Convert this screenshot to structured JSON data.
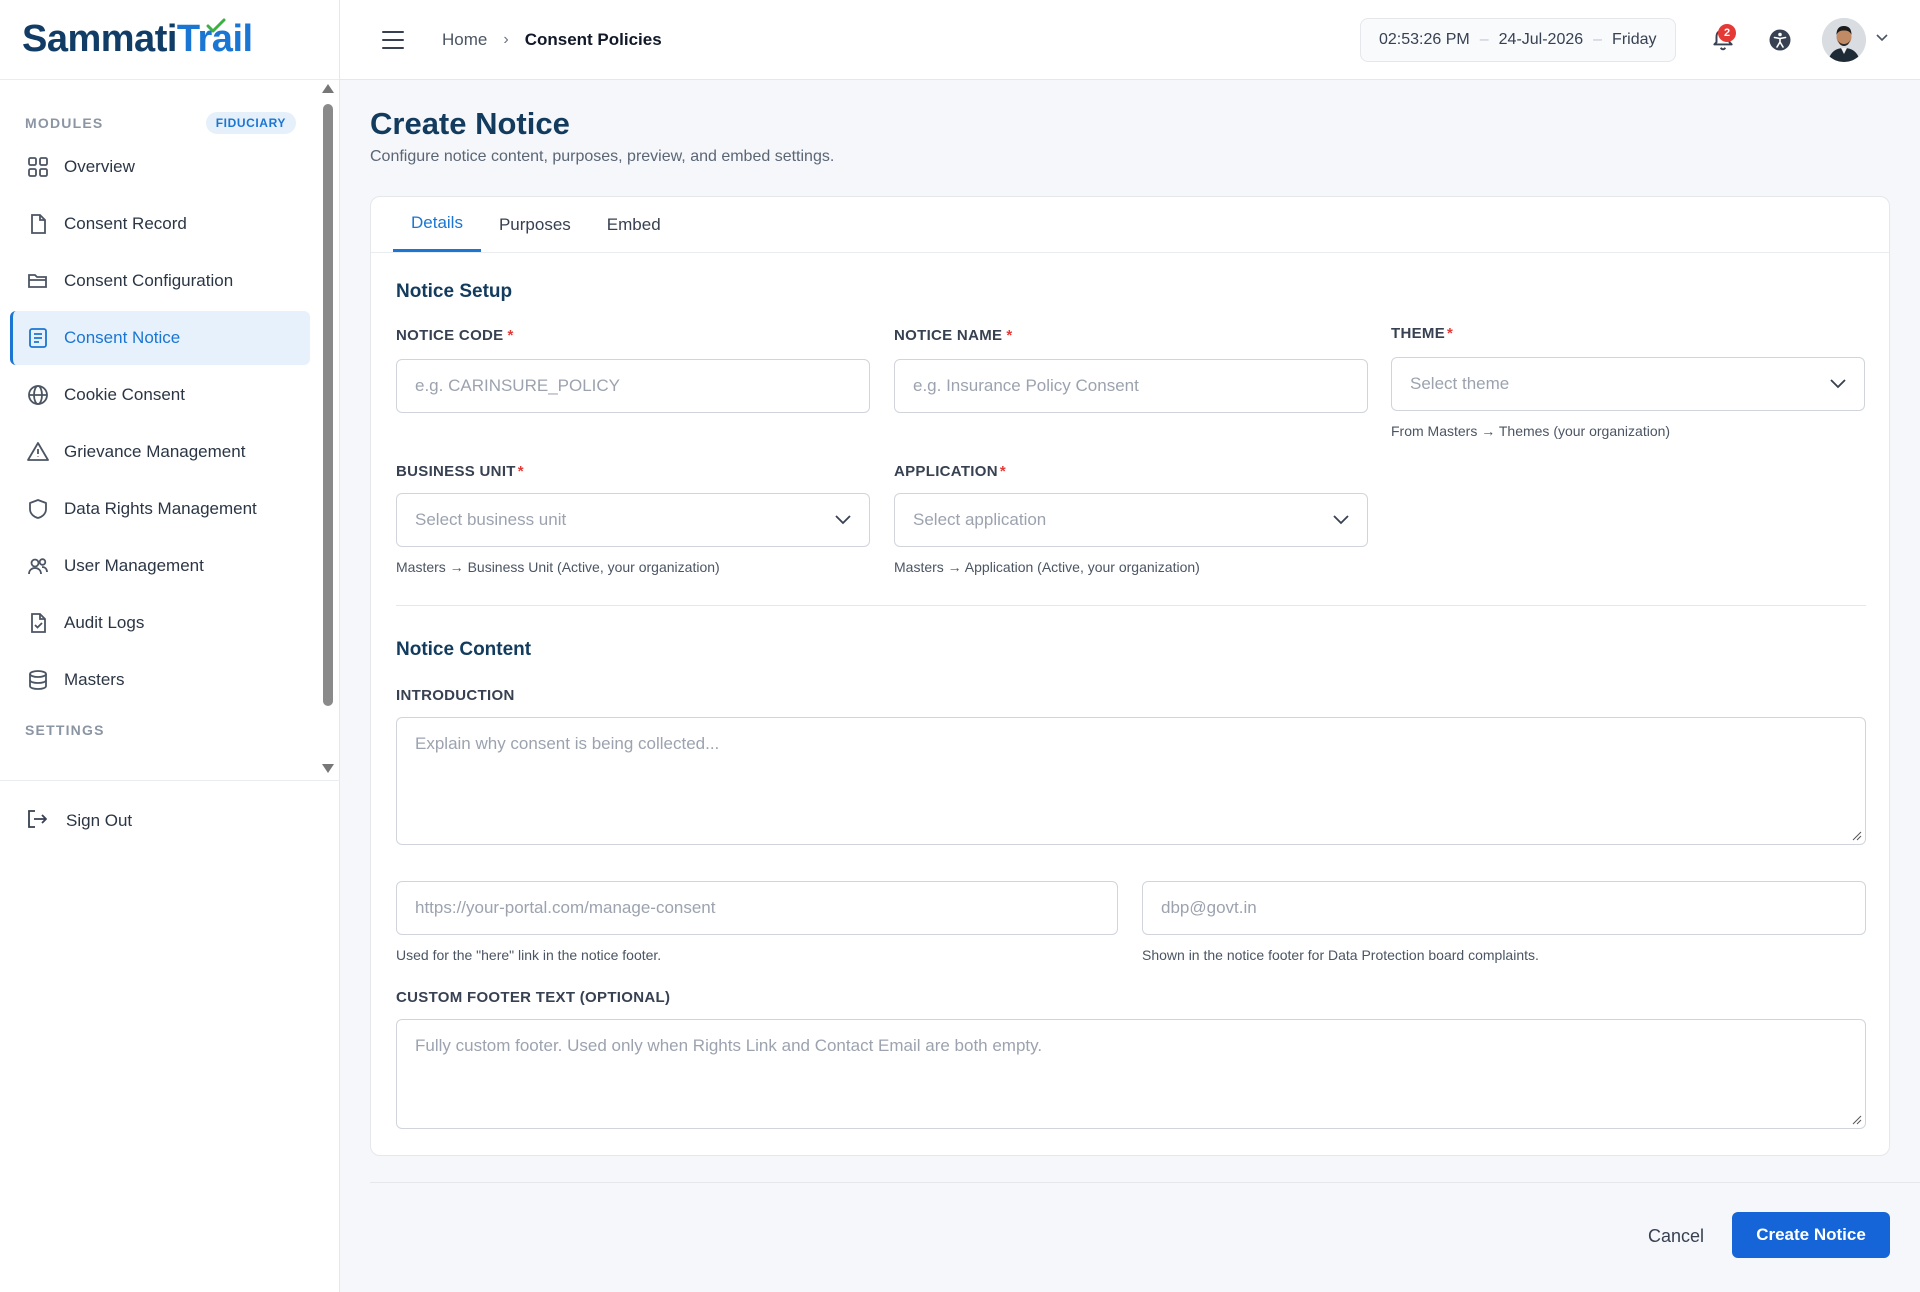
{
  "brand": {
    "part1": "Sammati",
    "part2": "Trail"
  },
  "sidebar": {
    "section_title": "MODULES",
    "badge": "FIDUCIARY",
    "items": [
      {
        "label": "Overview",
        "icon": "grid-icon"
      },
      {
        "label": "Consent Record",
        "icon": "file-icon"
      },
      {
        "label": "Consent Configuration",
        "icon": "folder-icon"
      },
      {
        "label": "Consent Notice",
        "icon": "notice-icon",
        "active": true
      },
      {
        "label": "Cookie Consent",
        "icon": "globe-icon"
      },
      {
        "label": "Grievance Management",
        "icon": "warning-icon"
      },
      {
        "label": "Data Rights Management",
        "icon": "shield-icon"
      },
      {
        "label": "User Management",
        "icon": "users-icon"
      },
      {
        "label": "Audit Logs",
        "icon": "file-check-icon"
      },
      {
        "label": "Masters",
        "icon": "database-icon"
      }
    ],
    "settings_title": "SETTINGS",
    "signout": "Sign Out"
  },
  "header": {
    "breadcrumb_home": "Home",
    "breadcrumb_current": "Consent Policies",
    "time": "02:53:26 PM",
    "date": "24-Jul-2026",
    "day": "Friday",
    "notification_count": "2"
  },
  "page": {
    "title": "Create Notice",
    "subtitle": "Configure notice content, purposes, preview, and embed settings."
  },
  "tabs": [
    "Details",
    "Purposes",
    "Embed"
  ],
  "form": {
    "setup_title": "Notice Setup",
    "notice_code_label": "NOTICE CODE",
    "notice_code_placeholder": "e.g. CARINSURE_POLICY",
    "notice_name_label": "NOTICE NAME",
    "notice_name_placeholder": "e.g. Insurance Policy Consent",
    "theme_label": "THEME",
    "theme_placeholder": "Select theme",
    "theme_hint": "From Masters → Themes (your organization)",
    "bu_label": "BUSINESS UNIT",
    "bu_placeholder": "Select business unit",
    "bu_hint": "Masters → Business Unit (Active, your organization)",
    "app_label": "APPLICATION",
    "app_placeholder": "Select application",
    "app_hint": "Masters → Application (Active, your organization)",
    "content_title": "Notice Content",
    "intro_label": "INTRODUCTION",
    "intro_placeholder": "Explain why consent is being collected...",
    "rights_placeholder": "https://your-portal.com/manage-consent",
    "rights_hint": "Used for the \"here\" link in the notice footer.",
    "email_placeholder": "dbp@govt.in",
    "email_hint": "Shown in the notice footer for Data Protection board complaints.",
    "footer_label": "CUSTOM FOOTER TEXT (OPTIONAL)",
    "footer_placeholder": "Fully custom footer. Used only when Rights Link and Contact Email are both empty."
  },
  "actions": {
    "cancel": "Cancel",
    "create": "Create Notice"
  },
  "colors": {
    "accent": "#1a76d2",
    "brand_dark": "#113c66",
    "required": "#e53935",
    "primary_button": "#1565d8"
  }
}
